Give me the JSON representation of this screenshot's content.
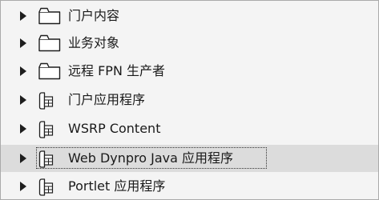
{
  "tree": {
    "items": [
      {
        "label": "门户内容",
        "icon": "folder-icon",
        "expandable": true,
        "selected": false
      },
      {
        "label": "业务对象",
        "icon": "folder-icon",
        "expandable": true,
        "selected": false
      },
      {
        "label": "远程 FPN 生产者",
        "icon": "folder-icon",
        "expandable": true,
        "selected": false
      },
      {
        "label": "门户应用程序",
        "icon": "application-package-icon",
        "expandable": true,
        "selected": false
      },
      {
        "label": "WSRP Content",
        "icon": "application-package-icon",
        "expandable": true,
        "selected": false
      },
      {
        "label": "Web Dynpro Java 应用程序",
        "icon": "application-package-icon",
        "expandable": true,
        "selected": true
      },
      {
        "label": "Portlet 应用程序",
        "icon": "application-package-icon",
        "expandable": true,
        "selected": false
      }
    ]
  }
}
